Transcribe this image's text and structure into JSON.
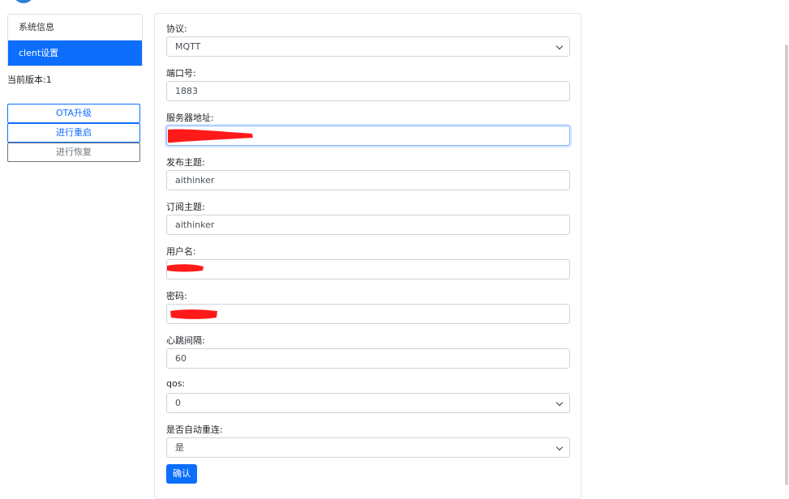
{
  "sidebar": {
    "items": [
      {
        "label": "系统信息",
        "active": false
      },
      {
        "label": "clent设置",
        "active": true
      }
    ],
    "version": "当前版本:1",
    "buttons": [
      {
        "label": "OTA升级"
      },
      {
        "label": "进行重启"
      },
      {
        "label": "进行恢复"
      }
    ]
  },
  "form": {
    "protocol": {
      "label": "协议:",
      "value": "MQTT"
    },
    "port": {
      "label": "端口号:",
      "value": "1883"
    },
    "server": {
      "label": "服务器地址:",
      "value": ""
    },
    "publish_topic": {
      "label": "发布主题:",
      "value": "aithinker"
    },
    "subscribe_topic": {
      "label": "订阅主题:",
      "value": "aithinker"
    },
    "username": {
      "label": "用户名:",
      "value": ""
    },
    "password": {
      "label": "密码:",
      "value": ""
    },
    "heartbeat": {
      "label": "心跳间隔:",
      "value": "60"
    },
    "qos": {
      "label": "qos:",
      "value": "0"
    },
    "auto_reconnect": {
      "label": "是否自动重连:",
      "value": "是"
    },
    "confirm_label": "确认"
  },
  "colors": {
    "accent": "#0d6efd",
    "redaction": "#ff1a1a"
  }
}
